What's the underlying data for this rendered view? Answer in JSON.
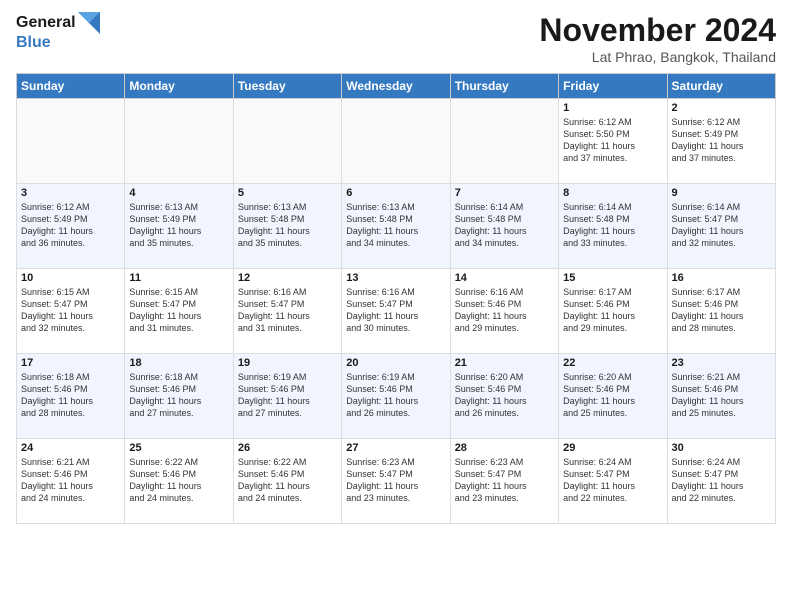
{
  "header": {
    "logo_line1": "General",
    "logo_line2": "Blue",
    "month_title": "November 2024",
    "location": "Lat Phrao, Bangkok, Thailand"
  },
  "calendar": {
    "days_of_week": [
      "Sunday",
      "Monday",
      "Tuesday",
      "Wednesday",
      "Thursday",
      "Friday",
      "Saturday"
    ],
    "weeks": [
      [
        {
          "day": "",
          "info": ""
        },
        {
          "day": "",
          "info": ""
        },
        {
          "day": "",
          "info": ""
        },
        {
          "day": "",
          "info": ""
        },
        {
          "day": "",
          "info": ""
        },
        {
          "day": "1",
          "info": "Sunrise: 6:12 AM\nSunset: 5:50 PM\nDaylight: 11 hours\nand 37 minutes."
        },
        {
          "day": "2",
          "info": "Sunrise: 6:12 AM\nSunset: 5:49 PM\nDaylight: 11 hours\nand 37 minutes."
        }
      ],
      [
        {
          "day": "3",
          "info": "Sunrise: 6:12 AM\nSunset: 5:49 PM\nDaylight: 11 hours\nand 36 minutes."
        },
        {
          "day": "4",
          "info": "Sunrise: 6:13 AM\nSunset: 5:49 PM\nDaylight: 11 hours\nand 35 minutes."
        },
        {
          "day": "5",
          "info": "Sunrise: 6:13 AM\nSunset: 5:48 PM\nDaylight: 11 hours\nand 35 minutes."
        },
        {
          "day": "6",
          "info": "Sunrise: 6:13 AM\nSunset: 5:48 PM\nDaylight: 11 hours\nand 34 minutes."
        },
        {
          "day": "7",
          "info": "Sunrise: 6:14 AM\nSunset: 5:48 PM\nDaylight: 11 hours\nand 34 minutes."
        },
        {
          "day": "8",
          "info": "Sunrise: 6:14 AM\nSunset: 5:48 PM\nDaylight: 11 hours\nand 33 minutes."
        },
        {
          "day": "9",
          "info": "Sunrise: 6:14 AM\nSunset: 5:47 PM\nDaylight: 11 hours\nand 32 minutes."
        }
      ],
      [
        {
          "day": "10",
          "info": "Sunrise: 6:15 AM\nSunset: 5:47 PM\nDaylight: 11 hours\nand 32 minutes."
        },
        {
          "day": "11",
          "info": "Sunrise: 6:15 AM\nSunset: 5:47 PM\nDaylight: 11 hours\nand 31 minutes."
        },
        {
          "day": "12",
          "info": "Sunrise: 6:16 AM\nSunset: 5:47 PM\nDaylight: 11 hours\nand 31 minutes."
        },
        {
          "day": "13",
          "info": "Sunrise: 6:16 AM\nSunset: 5:47 PM\nDaylight: 11 hours\nand 30 minutes."
        },
        {
          "day": "14",
          "info": "Sunrise: 6:16 AM\nSunset: 5:46 PM\nDaylight: 11 hours\nand 29 minutes."
        },
        {
          "day": "15",
          "info": "Sunrise: 6:17 AM\nSunset: 5:46 PM\nDaylight: 11 hours\nand 29 minutes."
        },
        {
          "day": "16",
          "info": "Sunrise: 6:17 AM\nSunset: 5:46 PM\nDaylight: 11 hours\nand 28 minutes."
        }
      ],
      [
        {
          "day": "17",
          "info": "Sunrise: 6:18 AM\nSunset: 5:46 PM\nDaylight: 11 hours\nand 28 minutes."
        },
        {
          "day": "18",
          "info": "Sunrise: 6:18 AM\nSunset: 5:46 PM\nDaylight: 11 hours\nand 27 minutes."
        },
        {
          "day": "19",
          "info": "Sunrise: 6:19 AM\nSunset: 5:46 PM\nDaylight: 11 hours\nand 27 minutes."
        },
        {
          "day": "20",
          "info": "Sunrise: 6:19 AM\nSunset: 5:46 PM\nDaylight: 11 hours\nand 26 minutes."
        },
        {
          "day": "21",
          "info": "Sunrise: 6:20 AM\nSunset: 5:46 PM\nDaylight: 11 hours\nand 26 minutes."
        },
        {
          "day": "22",
          "info": "Sunrise: 6:20 AM\nSunset: 5:46 PM\nDaylight: 11 hours\nand 25 minutes."
        },
        {
          "day": "23",
          "info": "Sunrise: 6:21 AM\nSunset: 5:46 PM\nDaylight: 11 hours\nand 25 minutes."
        }
      ],
      [
        {
          "day": "24",
          "info": "Sunrise: 6:21 AM\nSunset: 5:46 PM\nDaylight: 11 hours\nand 24 minutes."
        },
        {
          "day": "25",
          "info": "Sunrise: 6:22 AM\nSunset: 5:46 PM\nDaylight: 11 hours\nand 24 minutes."
        },
        {
          "day": "26",
          "info": "Sunrise: 6:22 AM\nSunset: 5:46 PM\nDaylight: 11 hours\nand 24 minutes."
        },
        {
          "day": "27",
          "info": "Sunrise: 6:23 AM\nSunset: 5:47 PM\nDaylight: 11 hours\nand 23 minutes."
        },
        {
          "day": "28",
          "info": "Sunrise: 6:23 AM\nSunset: 5:47 PM\nDaylight: 11 hours\nand 23 minutes."
        },
        {
          "day": "29",
          "info": "Sunrise: 6:24 AM\nSunset: 5:47 PM\nDaylight: 11 hours\nand 22 minutes."
        },
        {
          "day": "30",
          "info": "Sunrise: 6:24 AM\nSunset: 5:47 PM\nDaylight: 11 hours\nand 22 minutes."
        }
      ]
    ]
  }
}
